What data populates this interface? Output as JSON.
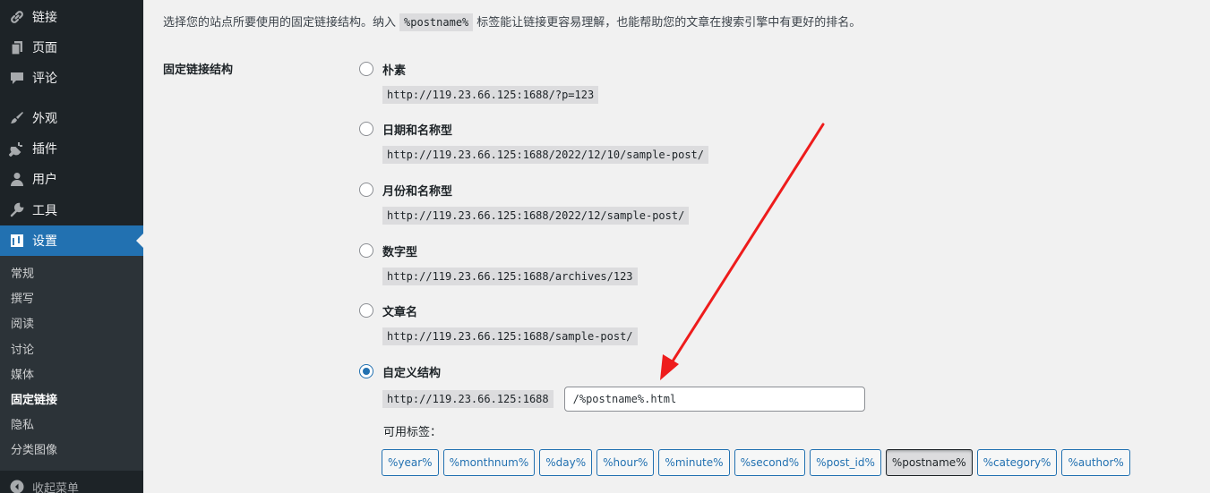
{
  "sidebar": {
    "menu": [
      {
        "label": "链接",
        "icon": "link-icon"
      },
      {
        "label": "页面",
        "icon": "page-icon"
      },
      {
        "label": "评论",
        "icon": "comment-icon"
      },
      {
        "label": "外观",
        "icon": "brush-icon"
      },
      {
        "label": "插件",
        "icon": "plugin-icon"
      },
      {
        "label": "用户",
        "icon": "user-icon"
      },
      {
        "label": "工具",
        "icon": "wrench-icon"
      },
      {
        "label": "设置",
        "icon": "settings-icon",
        "current": true
      }
    ],
    "submenu": [
      "常规",
      "撰写",
      "阅读",
      "讨论",
      "媒体",
      "固定链接",
      "隐私",
      "分类图像"
    ],
    "submenu_current": "固定链接",
    "collapse_label": "收起菜单"
  },
  "intro": {
    "before": "选择您的站点所要使用的固定链接结构。纳入",
    "code": "%postname%",
    "after": "标签能让链接更容易理解，也能帮助您的文章在搜索引擎中有更好的排名。"
  },
  "row_label": "固定链接结构",
  "options": [
    {
      "label": "朴素",
      "url": "http://119.23.66.125:1688/?p=123",
      "checked": false
    },
    {
      "label": "日期和名称型",
      "url": "http://119.23.66.125:1688/2022/12/10/sample-post/",
      "checked": false
    },
    {
      "label": "月份和名称型",
      "url": "http://119.23.66.125:1688/2022/12/sample-post/",
      "checked": false
    },
    {
      "label": "数字型",
      "url": "http://119.23.66.125:1688/archives/123",
      "checked": false
    },
    {
      "label": "文章名",
      "url": "http://119.23.66.125:1688/sample-post/",
      "checked": false
    },
    {
      "label": "自定义结构",
      "checked": true
    }
  ],
  "custom": {
    "base": "http://119.23.66.125:1688",
    "value": "/%postname%.html"
  },
  "tags_label": "可用标签：",
  "tags": [
    "%year%",
    "%monthnum%",
    "%day%",
    "%hour%",
    "%minute%",
    "%second%",
    "%post_id%",
    "%postname%",
    "%category%",
    "%author%"
  ],
  "active_tag": "%postname%",
  "colors": {
    "sidebar_bg": "#1d2327",
    "submenu_bg": "#2c3338",
    "accent": "#2271b1",
    "annotation_arrow": "#ee1c1c"
  }
}
